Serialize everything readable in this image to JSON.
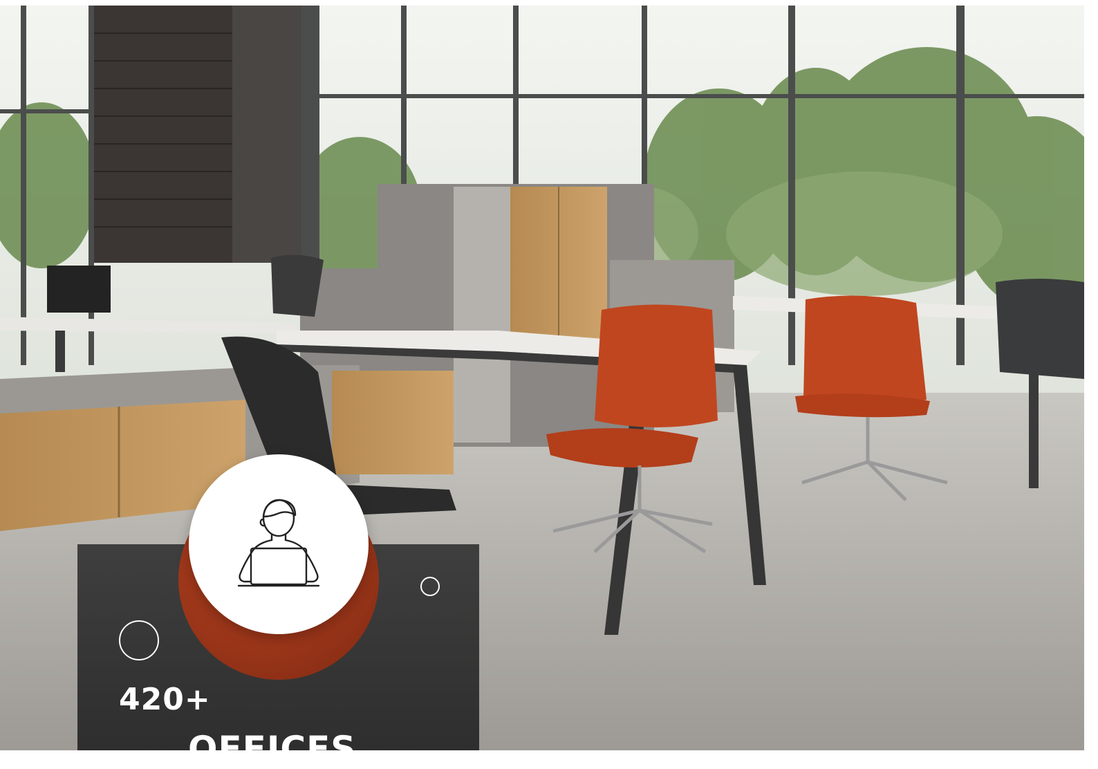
{
  "photo": {
    "description_icon": "office-interior-photo",
    "accent_color": "#9a3519"
  },
  "stat": {
    "value": "420+",
    "label": "OFFICES",
    "icon": "person-at-laptop-icon",
    "card_color": "#333333"
  }
}
